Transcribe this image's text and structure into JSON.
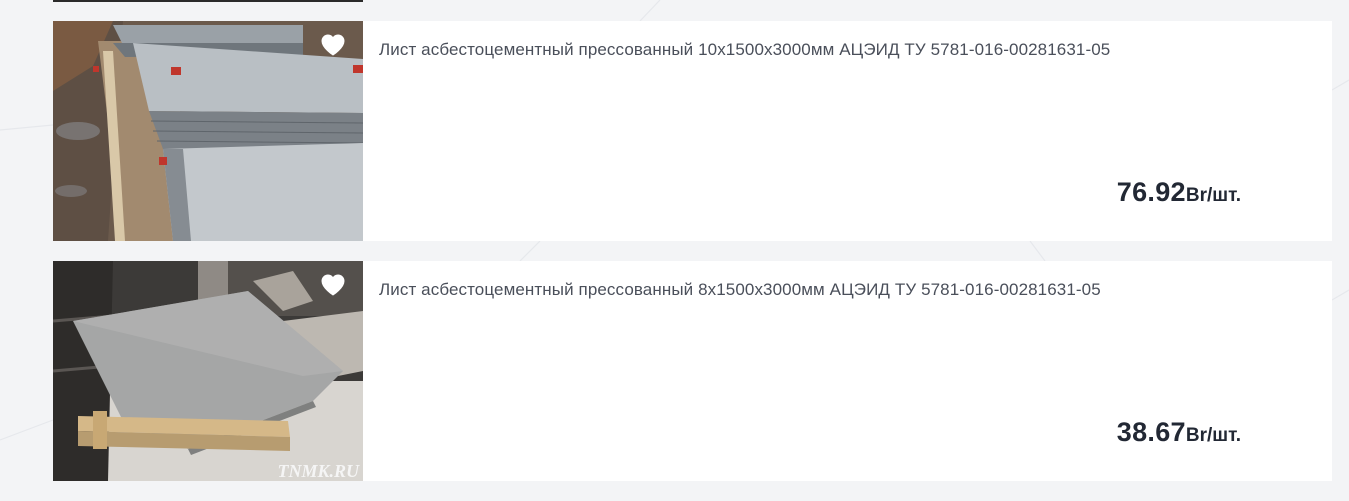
{
  "products": [
    {
      "title": "Лист асбестоцементный прессованный 10x1500x3000мм АЦЭИД ТУ 5781-016-00281631-05",
      "price": "76.92",
      "unit": "Br/шт."
    },
    {
      "title": "Лист асбестоцементный прессованный 8x1500x3000мм АЦЭИД ТУ 5781-016-00281631-05",
      "price": "38.67",
      "unit": "Br/шт.",
      "image_watermark": "TNMK.RU"
    }
  ],
  "icons": {
    "favorite": "heart-icon"
  },
  "colors": {
    "page_background": "#f3f4f6",
    "card_background": "#ffffff",
    "title_text": "#4a4f5a",
    "price_text": "#222834"
  }
}
